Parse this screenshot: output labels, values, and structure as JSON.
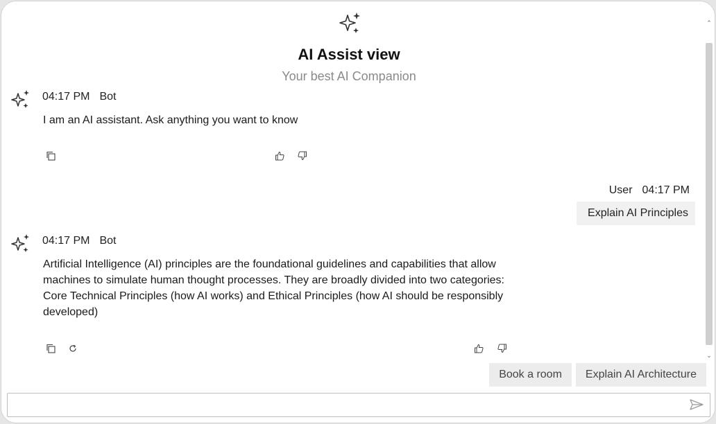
{
  "header": {
    "title": "AI Assist view",
    "subtitle": "Your best AI Companion"
  },
  "messages": [
    {
      "role": "bot",
      "time": "04:17 PM",
      "author": "Bot",
      "text": "I am an AI assistant. Ask anything you want to know",
      "icons": [
        "copy-icon",
        "thumbs-up-icon",
        "thumbs-down-icon"
      ]
    },
    {
      "role": "user",
      "time": "04:17 PM",
      "author": "User",
      "text": "Explain AI Principles"
    },
    {
      "role": "bot",
      "time": "04:17 PM",
      "author": "Bot",
      "text": "Artificial Intelligence (AI) principles are the foundational guidelines and capabilities that allow machines to simulate human thought processes. They are broadly divided into two categories: Core Technical Principles (how AI works) and Ethical Principles (how AI should be responsibly developed)",
      "icons": [
        "copy-icon",
        "regenerate-icon",
        "thumbs-up-icon",
        "thumbs-down-icon"
      ]
    }
  ],
  "suggestions": [
    "Book a room",
    "Explain AI Architecture"
  ],
  "input": {
    "value": "",
    "placeholder": ""
  },
  "icons": {
    "header": "sparkle-icon",
    "send": "send-icon"
  }
}
